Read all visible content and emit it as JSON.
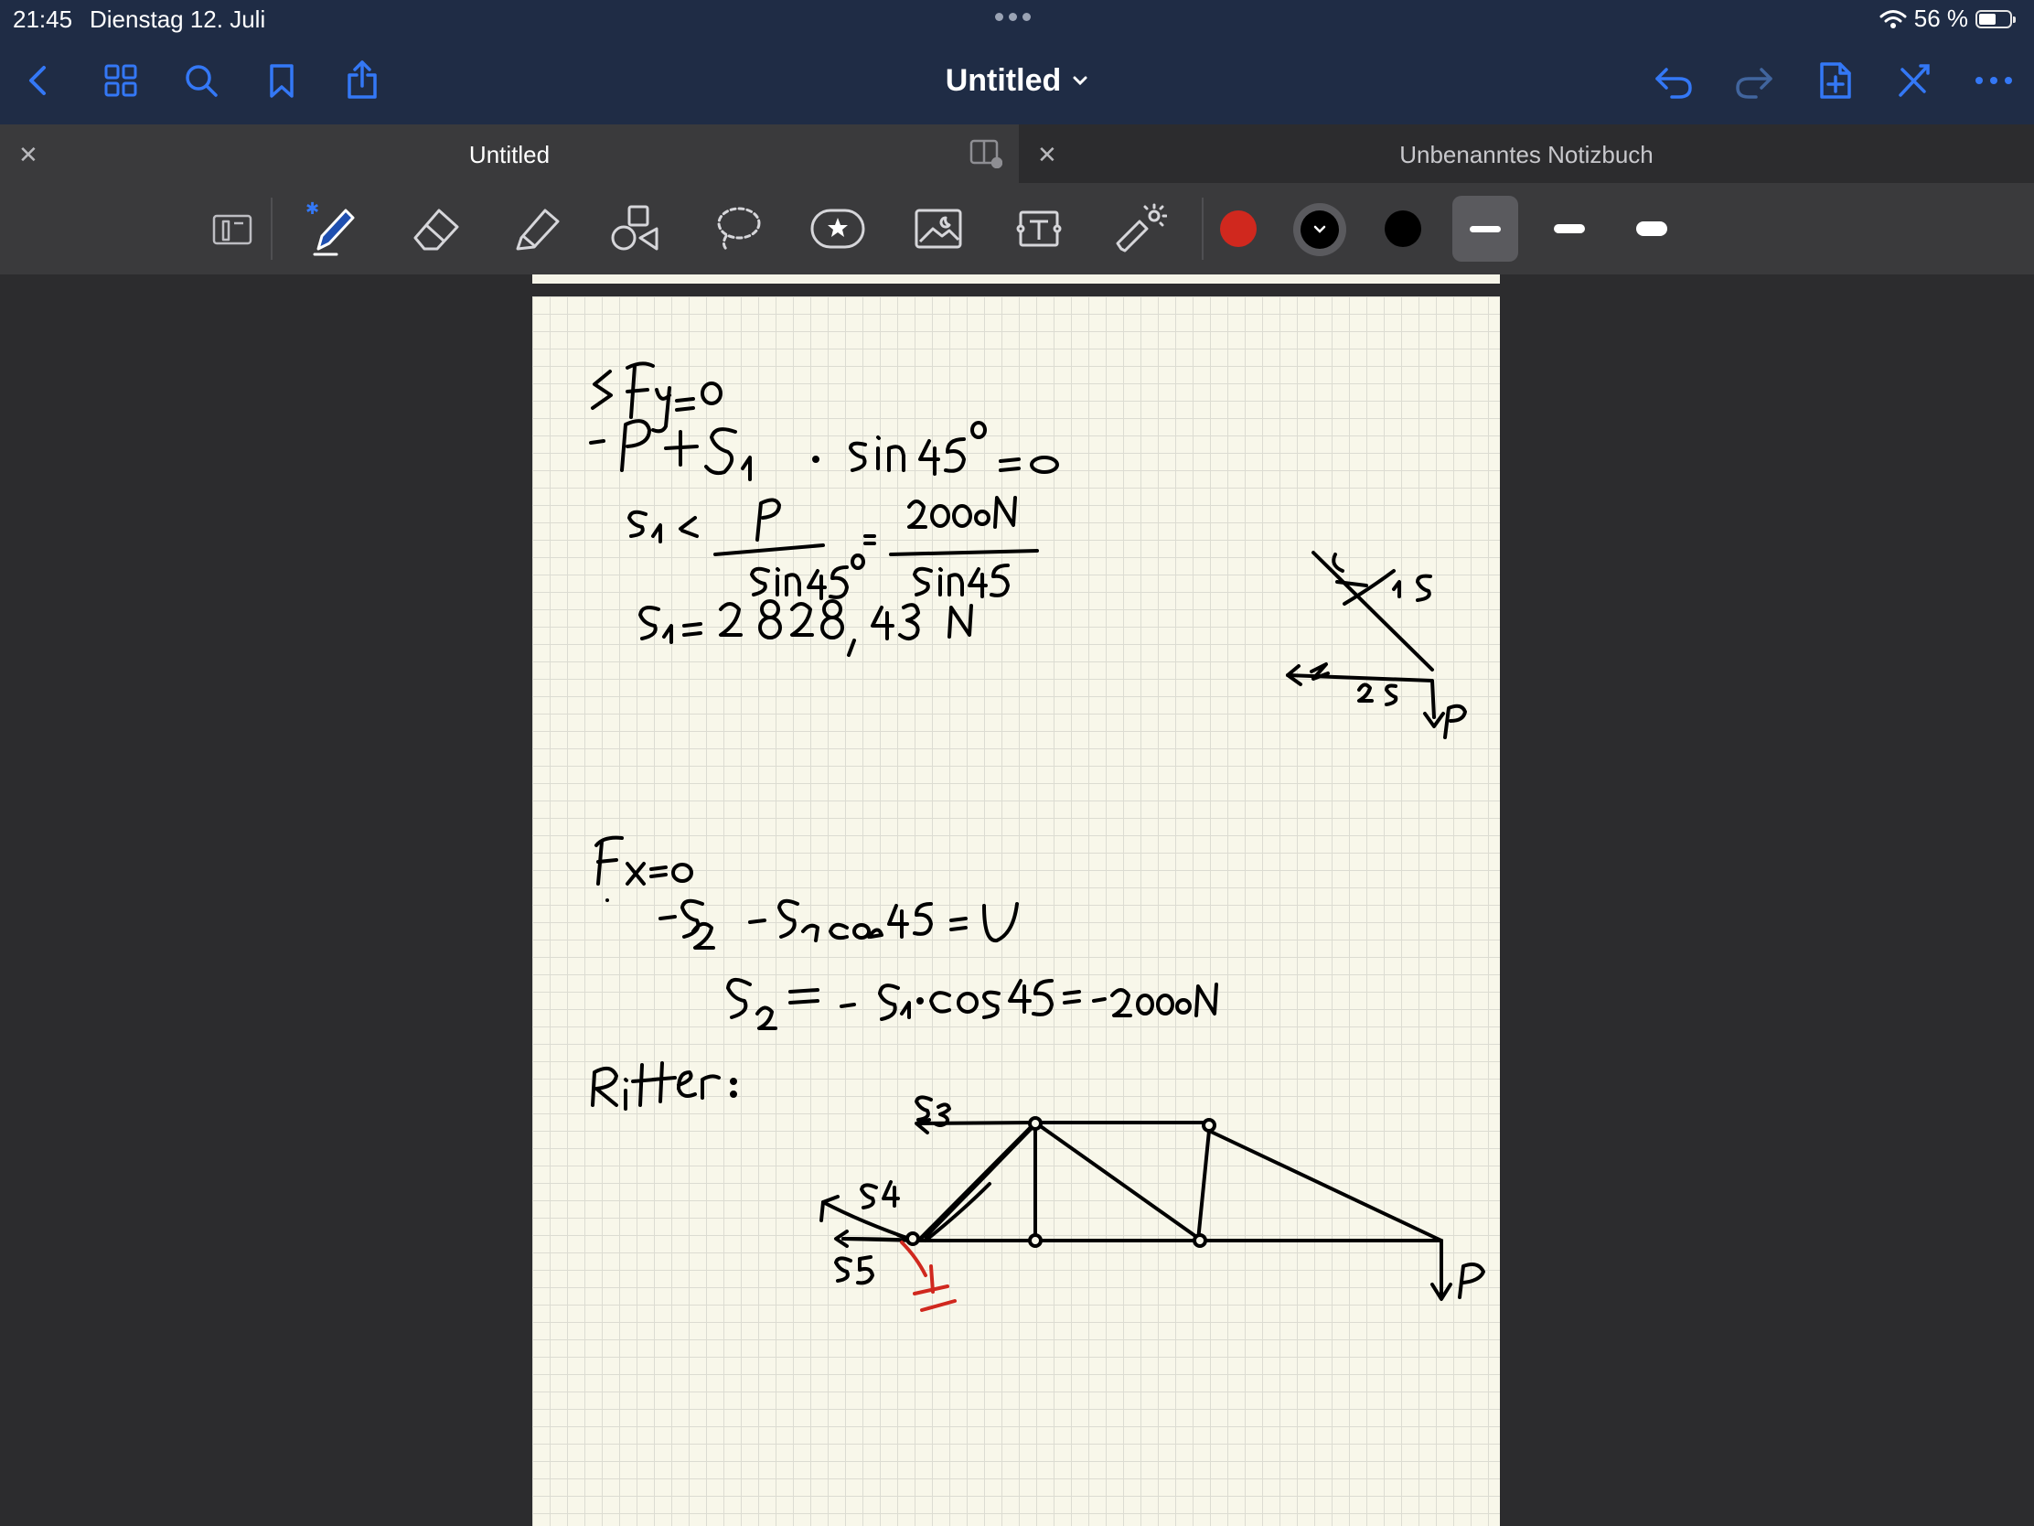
{
  "status_bar": {
    "time": "21:45",
    "date": "Dienstag 12. Juli",
    "battery_text": "56 %",
    "battery_level": 0.56
  },
  "nav": {
    "title": "Untitled",
    "left_icons": [
      "back-icon",
      "grid-icon",
      "search-icon",
      "bookmark-icon",
      "share-icon"
    ],
    "right_icons": [
      "undo-icon",
      "redo-icon",
      "add-page-icon",
      "close-pen-icon",
      "more-icon"
    ]
  },
  "tabs": [
    {
      "label": "Untitled",
      "active": true
    },
    {
      "label": "Unbenanntes Notizbuch",
      "active": false
    }
  ],
  "toolbar": {
    "tools": [
      "read-only-icon",
      "pen-icon",
      "eraser-icon",
      "highlighter-icon",
      "shapes-icon",
      "lasso-icon",
      "sticker-icon",
      "image-icon",
      "text-icon",
      "laser-pointer-icon"
    ],
    "colors": {
      "red": "#d0281e",
      "selected": "#000000",
      "black": "#000000"
    },
    "accent": "#3478f6"
  },
  "notes": {
    "line1": "ΣFy = 0",
    "line2": "-P + S1 · sin 45° = 0",
    "line3": "S1 = P / sin 45° = 2000 N / sin 45",
    "line4": "S1 = 2 828,43 N",
    "line5": "Fx = 0",
    "line6": "-S2 - S1 cos 45 = 0",
    "line7": "S2 = - S1 · cos 45 = -2000 N",
    "line8": "Ritter:",
    "sketch_labels": [
      "S3",
      "S4",
      "S5",
      "P",
      "I",
      "1 S",
      "2 S"
    ]
  }
}
